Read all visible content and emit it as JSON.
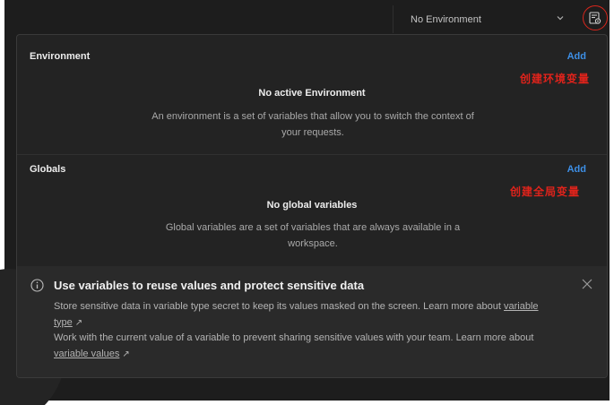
{
  "topbar": {
    "environment_select": "No Environment",
    "environment_button_icon": "environment-quick-look-icon"
  },
  "environment": {
    "title": "Environment",
    "add_label": "Add",
    "annotation": "创建环境变量",
    "empty_title": "No active Environment",
    "empty_desc": "An environment is a set of variables that allow you to switch the context of your requests."
  },
  "globals": {
    "title": "Globals",
    "add_label": "Add",
    "annotation": "创建全局变量",
    "empty_title": "No global variables",
    "empty_desc": "Global variables are a set of variables that are always available in a workspace."
  },
  "banner": {
    "title": "Use variables to reuse values and protect sensitive data",
    "line1": "Store sensitive data in variable type secret to keep its values masked on the screen. Learn more about",
    "link1": "variable type",
    "line2": "Work with the current value of a variable to prevent sharing sensitive values with your team. Learn more about",
    "link2": "variable values",
    "arrow": "↗"
  },
  "colors": {
    "accent": "#3d8fe6",
    "annotation": "#e0231b",
    "background": "#1d1d1d"
  }
}
